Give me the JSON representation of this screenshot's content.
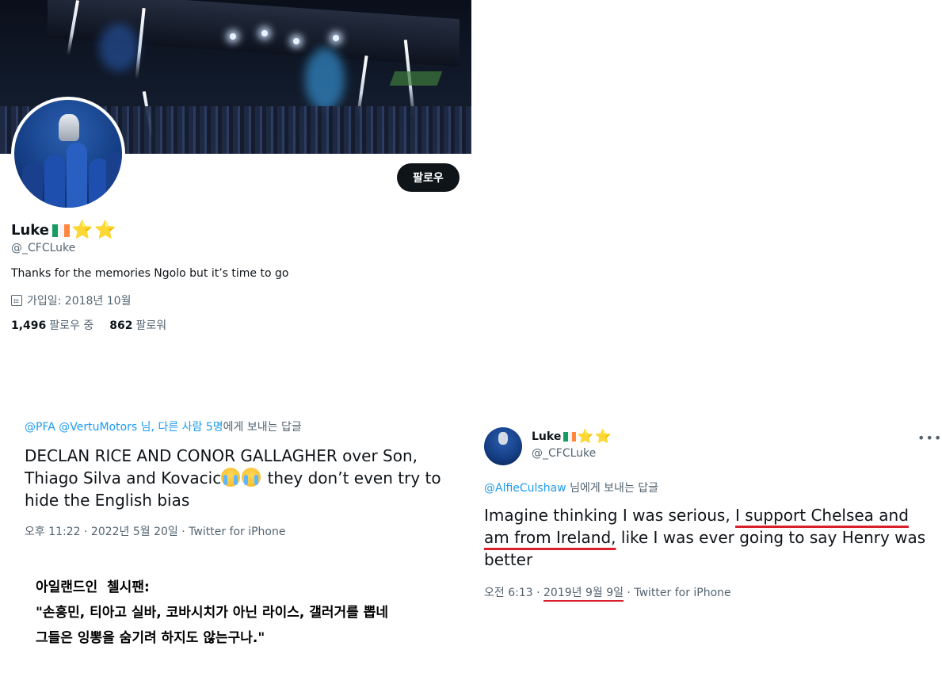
{
  "profile": {
    "follow_button": "팔로우",
    "name": "Luke",
    "flag_colors": [
      "#169b62",
      "#ffffff",
      "#ff883e"
    ],
    "badges": [
      "⭐",
      "⭐"
    ],
    "handle": "@_CFCLuke",
    "bio": "Thanks for the memories Ngolo but it’s time to go",
    "joined": "가입일: 2018년 10월",
    "following_count": "1,496",
    "following_label": "팔로우 중",
    "followers_count": "862",
    "followers_label": "팔로워"
  },
  "tweet1": {
    "reply_mentions": "@PFA @VertuMotors",
    "reply_others": "님, 다른 사람 5명",
    "reply_suffix": "에게 보내는 답글",
    "text_part1": "DECLAN RICE AND CONOR GALLAGHER over Son, Thiago Silva and Kovacic",
    "emoji_name": "loudly-crying-face",
    "text_part2": " they don’t even try to hide the English bias",
    "meta": "오후 11:22 · 2022년 5월 20일 · Twitter for iPhone"
  },
  "korean_caption": {
    "line1": "아일랜드인  첼시팬:",
    "line2": "\"손흥민, 티아고 실바, 코바시치가 아닌 라이스, 갤러거를 뽑네",
    "line3": "그들은 잉뽕을 숨기려 하지도 않는구나.\""
  },
  "tweet2": {
    "name": "Luke",
    "handle": "@_CFCLuke",
    "reply_mention": "@AlfieCulshaw",
    "reply_suffix": " 님에게 보내는 답글",
    "text_part1": "Imagine thinking I was serious, ",
    "text_underlined1": "I support Chelsea and",
    "text_underlined2": "am from Ireland,",
    "text_part2": " like I was ever going to say Henry was better",
    "meta_time": "오전 6:13 · ",
    "meta_date": "2019년 9월 9일",
    "meta_source": " · Twitter for iPhone",
    "underline_color": "#d9202a"
  }
}
